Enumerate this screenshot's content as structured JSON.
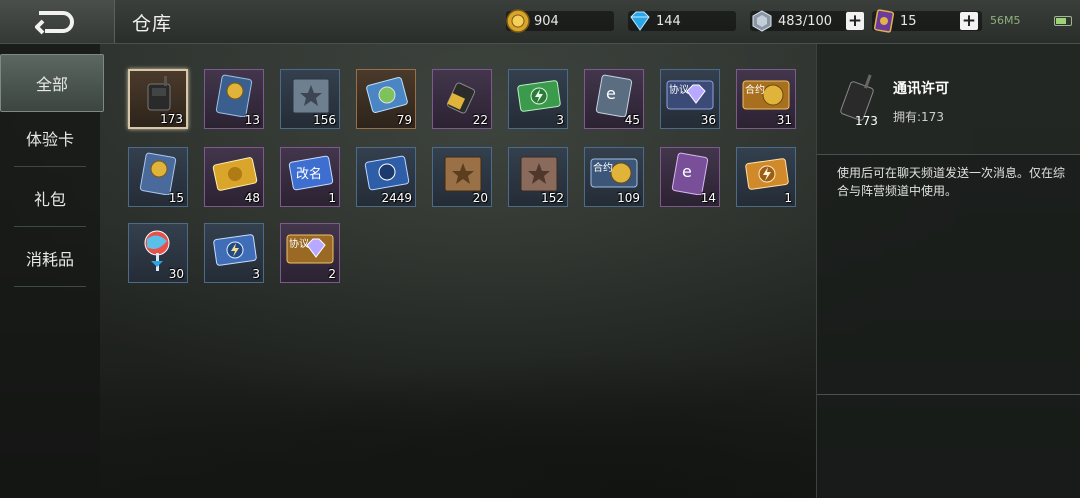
{
  "header": {
    "title": "仓库",
    "back_icon": "back-arrow-icon"
  },
  "resources": [
    {
      "name": "gold",
      "icon": "gold-coin-icon",
      "value": "904"
    },
    {
      "name": "diamond",
      "icon": "diamond-icon",
      "value": "144"
    },
    {
      "name": "crystal",
      "icon": "crystal-icon",
      "value": "483/100",
      "has_plus": true
    },
    {
      "name": "ticket",
      "icon": "ticket-card-icon",
      "value": "15",
      "has_plus": true
    }
  ],
  "status": {
    "network": "56M5",
    "battery": "battery-icon"
  },
  "sidebar": {
    "tabs": [
      {
        "label": "全部",
        "active": true
      },
      {
        "label": "体验卡",
        "active": false
      },
      {
        "label": "礼包",
        "active": false
      },
      {
        "label": "消耗品",
        "active": false
      }
    ]
  },
  "items": [
    {
      "name": "walkie-talkie",
      "count": "173",
      "rarity": "gold",
      "selected": true
    },
    {
      "name": "double-gold-card",
      "count": "13",
      "rarity": "purple"
    },
    {
      "name": "blue-star-book",
      "count": "156",
      "rarity": "blue"
    },
    {
      "name": "globe-ticket",
      "count": "79",
      "rarity": "gold"
    },
    {
      "name": "gold-walkie-talkie",
      "count": "22",
      "rarity": "purple"
    },
    {
      "name": "green-lightning-card",
      "count": "3",
      "rarity": "blue"
    },
    {
      "name": "double-exp-card",
      "count": "45",
      "rarity": "purple"
    },
    {
      "name": "agreement-diamond",
      "count": "36",
      "rarity": "blue",
      "label": "协议"
    },
    {
      "name": "contract-coin",
      "count": "31",
      "rarity": "purple",
      "label": "合约"
    },
    {
      "name": "double-gold-card-blue",
      "count": "15",
      "rarity": "blue"
    },
    {
      "name": "gold-ticket",
      "count": "48",
      "rarity": "purple"
    },
    {
      "name": "rename-card",
      "count": "1",
      "rarity": "purple",
      "label": "改名"
    },
    {
      "name": "blue-badge-ticket",
      "count": "2449",
      "rarity": "blue"
    },
    {
      "name": "gold-star-book",
      "count": "20",
      "rarity": "blue"
    },
    {
      "name": "bronze-star-book",
      "count": "152",
      "rarity": "blue"
    },
    {
      "name": "contract-coin-blue",
      "count": "109",
      "rarity": "blue",
      "label": "合约"
    },
    {
      "name": "double-exp-card-purple",
      "count": "14",
      "rarity": "purple"
    },
    {
      "name": "orange-lightning-card",
      "count": "1",
      "rarity": "blue"
    },
    {
      "name": "lollipop",
      "count": "30",
      "rarity": "blue"
    },
    {
      "name": "blue-lightning-card",
      "count": "3",
      "rarity": "blue"
    },
    {
      "name": "agreement-diamond-gold",
      "count": "2",
      "rarity": "purple",
      "label": "协议"
    }
  ],
  "detail": {
    "name": "通讯许可",
    "owned_label": "拥有:173",
    "count": "173",
    "description": "使用后可在聊天频道发送一次消息。仅在综合与阵营频道中使用。"
  }
}
